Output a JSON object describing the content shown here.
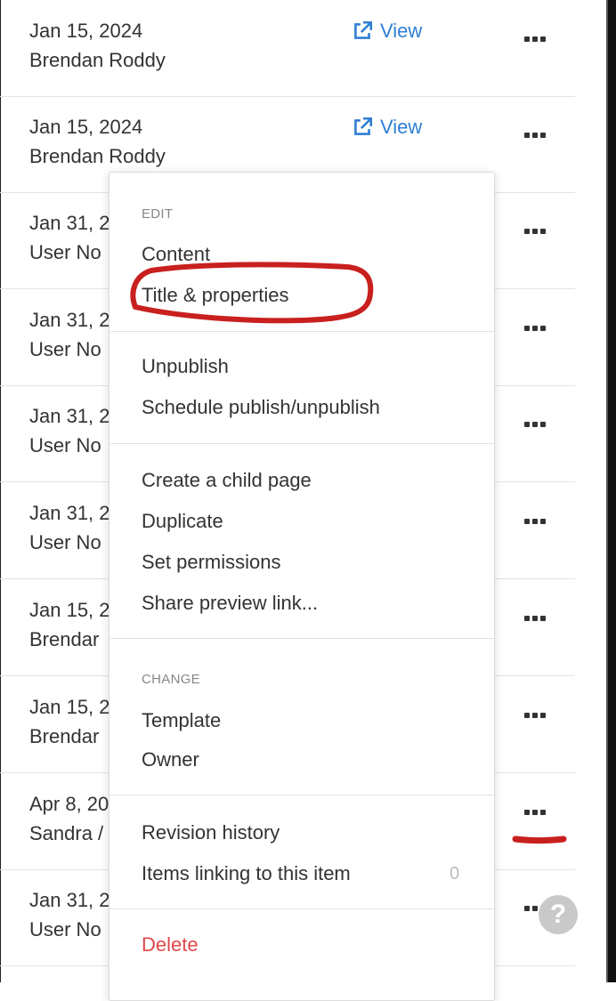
{
  "rows": [
    {
      "date": "Jan 15, 2024",
      "user": "Brendan Roddy",
      "view": "View"
    },
    {
      "date": "Jan 15, 2024",
      "user": "Brendan Roddy",
      "view": "View"
    },
    {
      "date": "Jan 31, 2",
      "user": "User No",
      "view": ""
    },
    {
      "date": "Jan 31, 2",
      "user": "User No",
      "view": ""
    },
    {
      "date": "Jan 31, 2",
      "user": "User No",
      "view": ""
    },
    {
      "date": "Jan 31, 2",
      "user": "User No",
      "view": ""
    },
    {
      "date": "Jan 15, 2",
      "user": "Brendar",
      "view": ""
    },
    {
      "date": "Jan 15, 2",
      "user": "Brendar",
      "view": ""
    },
    {
      "date": "Apr 8, 20",
      "user": "Sandra /",
      "view": ""
    },
    {
      "date": "Jan 31, 2",
      "user": "User No",
      "view": ""
    }
  ],
  "menu": {
    "edit_heading": "EDIT",
    "content": "Content",
    "title_properties": "Title & properties",
    "unpublish": "Unpublish",
    "schedule": "Schedule publish/unpublish",
    "create_child": "Create a child page",
    "duplicate": "Duplicate",
    "set_permissions": "Set permissions",
    "share_preview": "Share preview link...",
    "change_heading": "CHANGE",
    "template": "Template",
    "owner": "Owner",
    "revision_history": "Revision history",
    "items_linking": "Items linking to this item",
    "items_linking_count": "0",
    "delete": "Delete"
  },
  "help": {
    "label": "?"
  },
  "colors": {
    "link": "#2f7fd3",
    "delete": "#e0484b",
    "annotation": "#c8201f"
  }
}
